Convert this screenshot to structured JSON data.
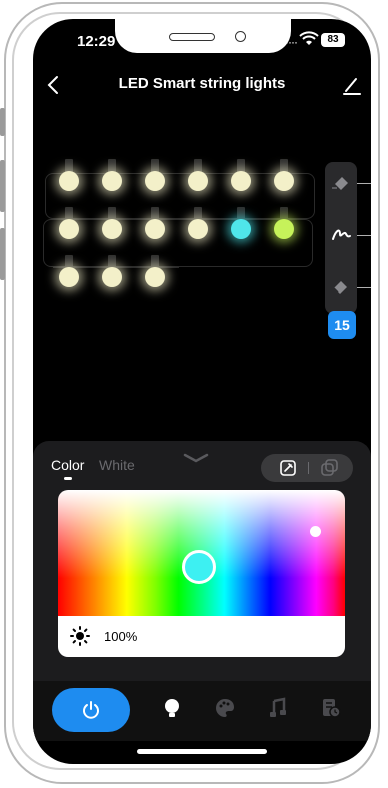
{
  "status_bar": {
    "time": "12:29",
    "battery": "83"
  },
  "header": {
    "title": "LED Smart string lights"
  },
  "tools": {
    "light_count": "15"
  },
  "panel": {
    "tabs": [
      {
        "label": "Color",
        "active": true
      },
      {
        "label": "White",
        "active": false
      }
    ],
    "brightness": "100%",
    "selected_color": "#3df0f2"
  },
  "bulbs": {
    "row1": [
      "#f3f0c9",
      "#f3f0c9",
      "#f3f0c9",
      "#f3f0c9",
      "#f3f0c9",
      "#f3f0c9"
    ],
    "row2": [
      "#f3f0c9",
      "#f3f0c9",
      "#f3f0c9",
      "#f3f0c9",
      "#4fe6ea",
      "#c6f25a"
    ],
    "row3": [
      "#f3f0c9",
      "#f3f0c9",
      "#f3f0c9"
    ]
  },
  "colors": {
    "accent": "#1e8cf0",
    "panel_bg": "#1c1c1e"
  },
  "bottom_nav": {
    "items": [
      {
        "icon": "power-icon",
        "active": true
      },
      {
        "icon": "bulb-icon",
        "active": true
      },
      {
        "icon": "palette-icon",
        "active": false
      },
      {
        "icon": "music-icon",
        "active": false
      },
      {
        "icon": "schedule-icon",
        "active": false
      }
    ]
  }
}
